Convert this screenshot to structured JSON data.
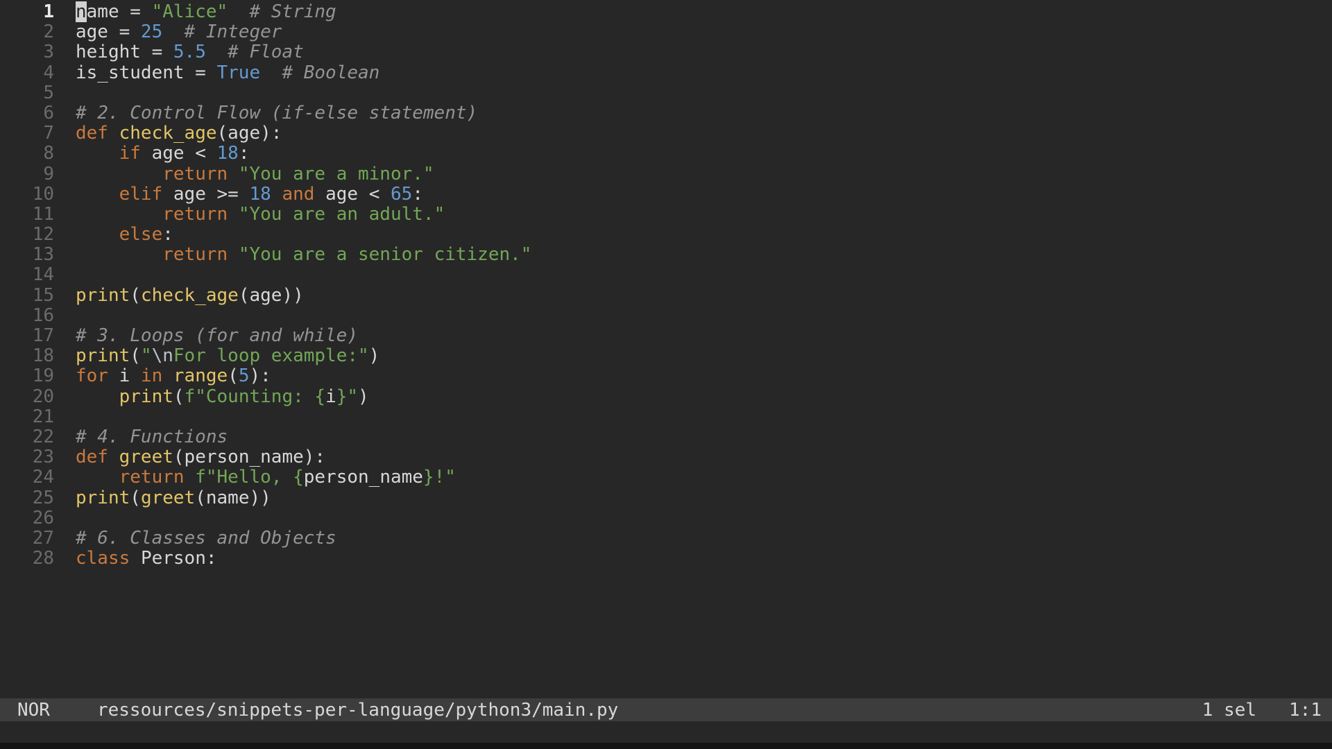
{
  "colors": {
    "bg": "#272727",
    "fg": "#d8d8d8",
    "gutter": "#6b6b6b",
    "gutter-current": "#e9e9e9",
    "keyword": "#ca7a3e",
    "function": "#e3c566",
    "string": "#73a757",
    "number": "#649ad2",
    "comment": "#949494",
    "escape": "#b9c2ca",
    "cursor-bg": "#d2d2d2",
    "cursor-fg": "#272727",
    "statusbar-bg": "#3d3d3d",
    "statusbar-fg": "#d8d8d8",
    "window-edge": "#141414"
  },
  "editor": {
    "language": "python",
    "lines": [
      {
        "n": "1",
        "current": true,
        "tokens": [
          [
            "cursor",
            "n"
          ],
          [
            "fg",
            "ame = "
          ],
          [
            "str",
            "\"Alice\""
          ],
          [
            "fg",
            "  "
          ],
          [
            "cmt",
            "# String"
          ]
        ]
      },
      {
        "n": "2",
        "tokens": [
          [
            "fg",
            "age = "
          ],
          [
            "num",
            "25"
          ],
          [
            "fg",
            "  "
          ],
          [
            "cmt",
            "# Integer"
          ]
        ]
      },
      {
        "n": "3",
        "tokens": [
          [
            "fg",
            "height = "
          ],
          [
            "num",
            "5.5"
          ],
          [
            "fg",
            "  "
          ],
          [
            "cmt",
            "# Float"
          ]
        ]
      },
      {
        "n": "4",
        "tokens": [
          [
            "fg",
            "is_student = "
          ],
          [
            "num",
            "True"
          ],
          [
            "fg",
            "  "
          ],
          [
            "cmt",
            "# Boolean"
          ]
        ]
      },
      {
        "n": "5",
        "tokens": []
      },
      {
        "n": "6",
        "tokens": [
          [
            "cmt",
            "# 2. Control Flow (if-else statement)"
          ]
        ]
      },
      {
        "n": "7",
        "tokens": [
          [
            "kw",
            "def"
          ],
          [
            "fg",
            " "
          ],
          [
            "fn",
            "check_age"
          ],
          [
            "fg",
            "(age):"
          ]
        ]
      },
      {
        "n": "8",
        "tokens": [
          [
            "fg",
            "    "
          ],
          [
            "kw",
            "if"
          ],
          [
            "fg",
            " age < "
          ],
          [
            "num",
            "18"
          ],
          [
            "fg",
            ":"
          ]
        ]
      },
      {
        "n": "9",
        "tokens": [
          [
            "fg",
            "        "
          ],
          [
            "kw",
            "return"
          ],
          [
            "fg",
            " "
          ],
          [
            "str",
            "\"You are a minor.\""
          ]
        ]
      },
      {
        "n": "10",
        "tokens": [
          [
            "fg",
            "    "
          ],
          [
            "kw",
            "elif"
          ],
          [
            "fg",
            " age >= "
          ],
          [
            "num",
            "18"
          ],
          [
            "fg",
            " "
          ],
          [
            "kw",
            "and"
          ],
          [
            "fg",
            " age < "
          ],
          [
            "num",
            "65"
          ],
          [
            "fg",
            ":"
          ]
        ]
      },
      {
        "n": "11",
        "tokens": [
          [
            "fg",
            "        "
          ],
          [
            "kw",
            "return"
          ],
          [
            "fg",
            " "
          ],
          [
            "str",
            "\"You are an adult.\""
          ]
        ]
      },
      {
        "n": "12",
        "tokens": [
          [
            "fg",
            "    "
          ],
          [
            "kw",
            "else"
          ],
          [
            "fg",
            ":"
          ]
        ]
      },
      {
        "n": "13",
        "tokens": [
          [
            "fg",
            "        "
          ],
          [
            "kw",
            "return"
          ],
          [
            "fg",
            " "
          ],
          [
            "str",
            "\"You are a senior citizen.\""
          ]
        ]
      },
      {
        "n": "14",
        "tokens": []
      },
      {
        "n": "15",
        "tokens": [
          [
            "fn",
            "print"
          ],
          [
            "fg",
            "("
          ],
          [
            "fn",
            "check_age"
          ],
          [
            "fg",
            "(age))"
          ]
        ]
      },
      {
        "n": "16",
        "tokens": []
      },
      {
        "n": "17",
        "tokens": [
          [
            "cmt",
            "# 3. Loops (for and while)"
          ]
        ]
      },
      {
        "n": "18",
        "tokens": [
          [
            "fn",
            "print"
          ],
          [
            "fg",
            "("
          ],
          [
            "str",
            "\""
          ],
          [
            "esc",
            "\\n"
          ],
          [
            "str",
            "For loop example:\""
          ],
          [
            "fg",
            ")"
          ]
        ]
      },
      {
        "n": "19",
        "tokens": [
          [
            "kw",
            "for"
          ],
          [
            "fg",
            " i "
          ],
          [
            "kw",
            "in"
          ],
          [
            "fg",
            " "
          ],
          [
            "fn",
            "range"
          ],
          [
            "fg",
            "("
          ],
          [
            "num",
            "5"
          ],
          [
            "fg",
            "):"
          ]
        ]
      },
      {
        "n": "20",
        "tokens": [
          [
            "fg",
            "    "
          ],
          [
            "fn",
            "print"
          ],
          [
            "fg",
            "("
          ],
          [
            "str",
            "f\"Counting: {"
          ],
          [
            "fg",
            "i"
          ],
          [
            "str",
            "}\""
          ],
          [
            "fg",
            ")"
          ]
        ]
      },
      {
        "n": "21",
        "tokens": []
      },
      {
        "n": "22",
        "tokens": [
          [
            "cmt",
            "# 4. Functions"
          ]
        ]
      },
      {
        "n": "23",
        "tokens": [
          [
            "kw",
            "def"
          ],
          [
            "fg",
            " "
          ],
          [
            "fn",
            "greet"
          ],
          [
            "fg",
            "(person_name):"
          ]
        ]
      },
      {
        "n": "24",
        "tokens": [
          [
            "fg",
            "    "
          ],
          [
            "kw",
            "return"
          ],
          [
            "fg",
            " "
          ],
          [
            "str",
            "f\"Hello, {"
          ],
          [
            "fg",
            "person_name"
          ],
          [
            "str",
            "}!\""
          ]
        ]
      },
      {
        "n": "25",
        "tokens": [
          [
            "fn",
            "print"
          ],
          [
            "fg",
            "("
          ],
          [
            "fn",
            "greet"
          ],
          [
            "fg",
            "(name))"
          ]
        ]
      },
      {
        "n": "26",
        "tokens": []
      },
      {
        "n": "27",
        "tokens": [
          [
            "cmt",
            "# 6. Classes and Objects"
          ]
        ]
      },
      {
        "n": "28",
        "tokens": [
          [
            "kw",
            "class"
          ],
          [
            "fg",
            " "
          ],
          [
            "fg",
            "Person:"
          ]
        ]
      }
    ]
  },
  "status_bar": {
    "mode": "NOR",
    "file_path": "ressources/snippets-per-language/python3/main.py",
    "selection_count": "1 sel",
    "cursor_position": "1:1"
  }
}
